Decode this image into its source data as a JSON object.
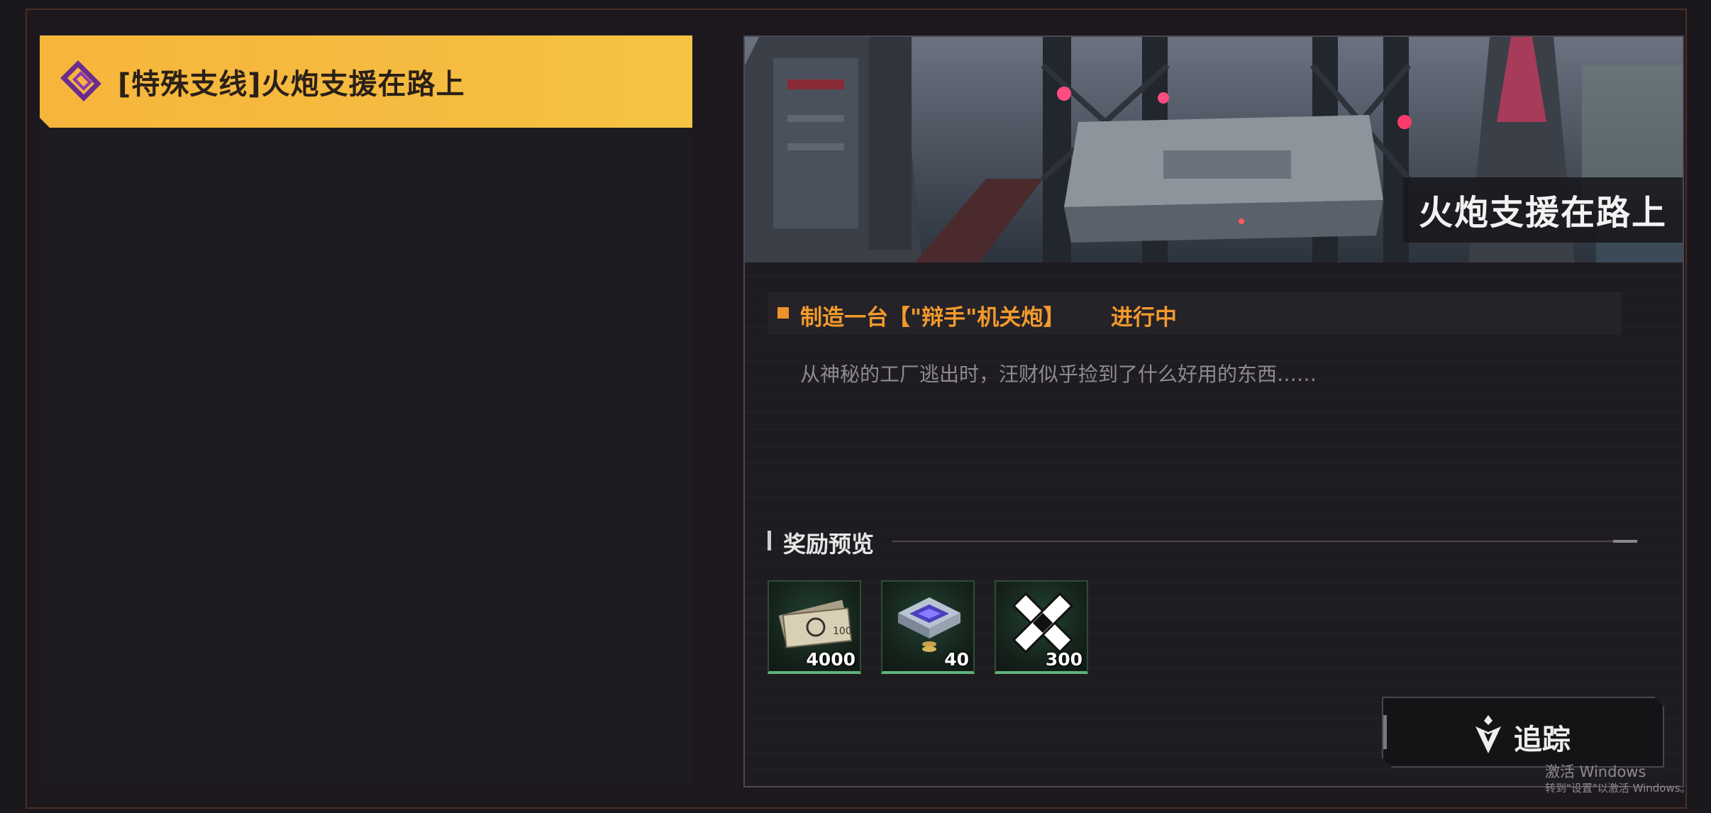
{
  "quest_list": {
    "items": [
      {
        "label": "[特殊支线]火炮支援在路上",
        "icon": "side-quest-icon",
        "selected": true
      }
    ]
  },
  "detail": {
    "banner_title": "火炮支援在路上",
    "objective": {
      "text": "制造一台【\"辩手\"机关炮】",
      "status": "进行中"
    },
    "description": "从神秘的工厂逃出时，汪财似乎捡到了什么好用的东西……",
    "rewards_title": "奖励预览",
    "rewards": [
      {
        "icon": "dennies-icon",
        "count": "4000"
      },
      {
        "icon": "chip-icon",
        "count": "40"
      },
      {
        "icon": "material-icon",
        "count": "300"
      }
    ],
    "track_button": "追踪"
  },
  "watermark": {
    "line1": "激活 Windows",
    "line2": "转到\"设置\"以激活 Windows。"
  },
  "colors": {
    "quest_highlight": "#f6b63b",
    "objective_text": "#f39a2c",
    "reward_border": "#5fb37a"
  }
}
